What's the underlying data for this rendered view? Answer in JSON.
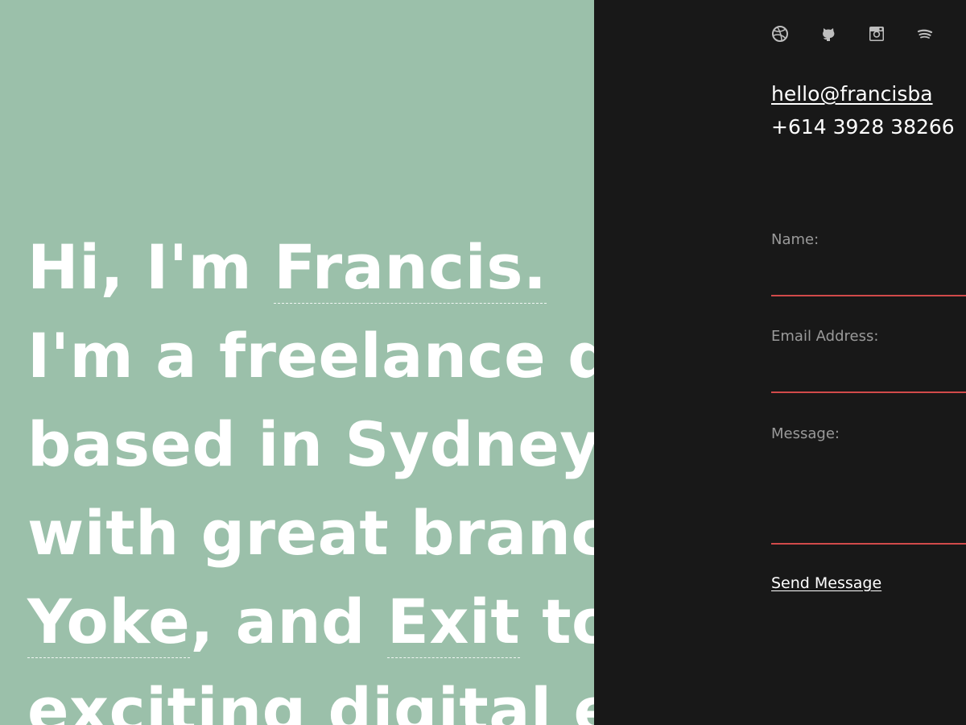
{
  "hero": {
    "greeting": "Hi, I'm ",
    "name_link": "Francis.",
    "line2": "I'm a freelance d",
    "line3": "based in Sydney",
    "line4": "with great branc",
    "brand_link_yoke": "Yoke",
    "line5_mid": ", and ",
    "brand_link_exit": "Exit",
    "line5_end": " to",
    "line6": "exciting digital e"
  },
  "social": {
    "icons": [
      "dribbble-icon",
      "github-icon",
      "instagram-icon",
      "spotify-icon"
    ]
  },
  "contact": {
    "email": "hello@francisba",
    "phone": "+614 3928 38266"
  },
  "form": {
    "name_label": "Name:",
    "email_label": "Email Address:",
    "message_label": "Message:",
    "send_label": "Send Message"
  },
  "colors": {
    "left_bg": "#9bc0aa",
    "right_bg": "#181818",
    "field_line": "#d14a4a",
    "label_text": "#9a9a9a",
    "text": "#ffffff"
  }
}
